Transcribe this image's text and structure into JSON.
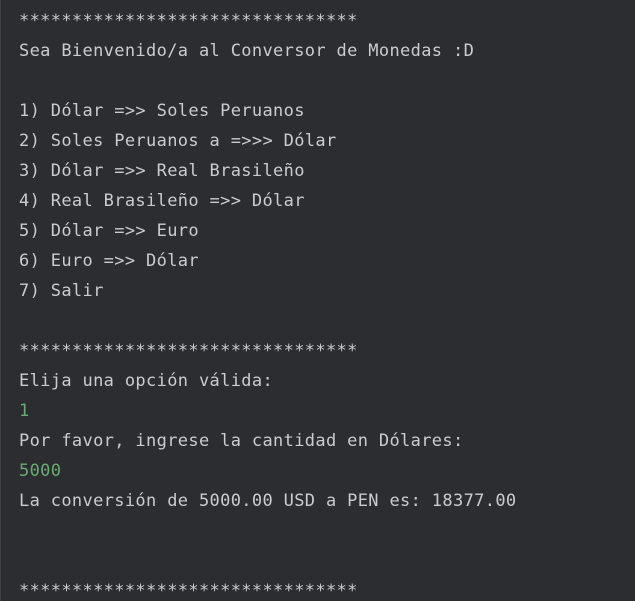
{
  "console": {
    "lines": [
      {
        "text": "********************************",
        "kind": "output"
      },
      {
        "text": "Sea Bienvenido/a al Conversor de Monedas :D",
        "kind": "output"
      },
      {
        "text": "",
        "kind": "output"
      },
      {
        "text": "1) Dólar =>> Soles Peruanos",
        "kind": "output"
      },
      {
        "text": "2) Soles Peruanos a =>>> Dólar",
        "kind": "output"
      },
      {
        "text": "3) Dólar =>> Real Brasileño",
        "kind": "output"
      },
      {
        "text": "4) Real Brasileño =>> Dólar",
        "kind": "output"
      },
      {
        "text": "5) Dólar =>> Euro",
        "kind": "output"
      },
      {
        "text": "6) Euro =>> Dólar",
        "kind": "output"
      },
      {
        "text": "7) Salir",
        "kind": "output"
      },
      {
        "text": "",
        "kind": "output"
      },
      {
        "text": "********************************",
        "kind": "output"
      },
      {
        "text": "Elija una opción válida:",
        "kind": "output"
      },
      {
        "text": "1",
        "kind": "input"
      },
      {
        "text": "Por favor, ingrese la cantidad en Dólares:",
        "kind": "output"
      },
      {
        "text": "5000",
        "kind": "input"
      },
      {
        "text": "La conversión de 5000.00 USD a PEN es: 18377.00",
        "kind": "output"
      },
      {
        "text": "",
        "kind": "output"
      },
      {
        "text": "",
        "kind": "output"
      },
      {
        "text": "********************************",
        "kind": "output"
      }
    ]
  },
  "colors": {
    "background": "#2b2d30",
    "output_text": "#c9ccd1",
    "user_input_text": "#6aab73"
  }
}
